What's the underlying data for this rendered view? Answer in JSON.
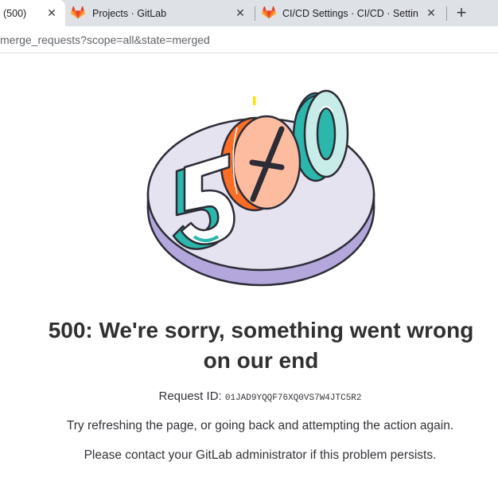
{
  "browser": {
    "tabs": [
      {
        "label": "(500)",
        "active": true
      },
      {
        "label": "Projects · GitLab",
        "active": false
      },
      {
        "label": "CI/CD Settings · CI/CD · Settings",
        "active": false
      }
    ],
    "close_glyph": "✕",
    "new_tab_glyph": "+",
    "url": "merge_requests?scope=all&state=merged"
  },
  "error": {
    "illustration_text": "500",
    "title_line1": "500: We're sorry, something went wrong",
    "title_line2": "on our end",
    "request_id_label": "Request ID:",
    "request_id": "01JAD9YQQF76XQ0VS7W4JTC5R2",
    "message_refresh": "Try refreshing the page, or going back and attempting the action again.",
    "message_contact": "Please contact your GitLab administrator if this problem persists."
  },
  "colors": {
    "gitlab_orange": "#e24329",
    "teal": "#2cb7ac",
    "plate_top": "#e5e3f0",
    "plate_side": "#b3a7dc",
    "coral": "#fc9d6b"
  }
}
